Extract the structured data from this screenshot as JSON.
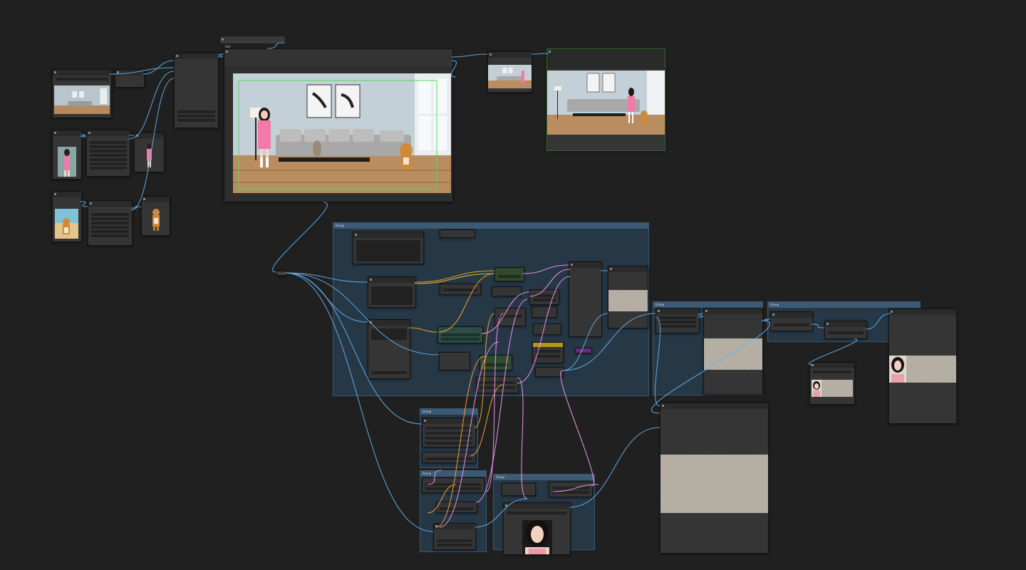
{
  "canvas": {
    "background": "#202020"
  },
  "wire_colors": {
    "image": "#64b5f6",
    "latent": "#ff9cf9",
    "conditioning": "#ffa931",
    "model": "#b39ddb",
    "clip": "#ffd500",
    "mask": "#81c784"
  },
  "groups": [
    {
      "name": "Group"
    },
    {
      "name": "Group"
    },
    {
      "name": "Group"
    },
    {
      "name": "Group"
    },
    {
      "name": "Group"
    },
    {
      "name": "Group"
    }
  ],
  "nodes": {
    "preview_label": "Ctrl"
  },
  "colors": {
    "group_fill": "#263746",
    "group_border": "#3a5670",
    "node_body": "#353535",
    "node_green": "#2f4a2f",
    "node_teal": "#2e4c46",
    "node_yellow": "#b8931e",
    "node_purple": "#6a2a7a"
  },
  "icons": [
    "node-dot-icon"
  ]
}
